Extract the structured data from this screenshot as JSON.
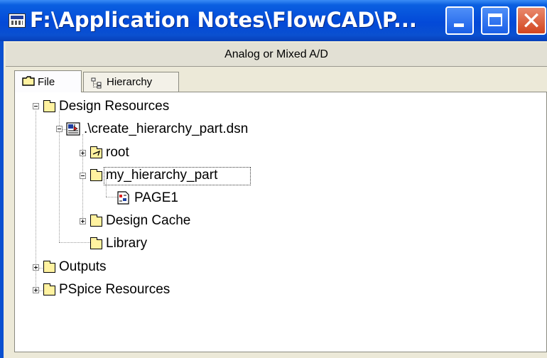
{
  "window": {
    "title": "F:\\Application Notes\\FlowCAD\\P...",
    "buttons": {
      "minimize": "minimize",
      "maximize": "maximize",
      "close": "close"
    }
  },
  "header": {
    "text": "Analog or Mixed A/D"
  },
  "tabs": [
    {
      "label": "File",
      "icon": "folder-icon",
      "active": true
    },
    {
      "label": "Hierarchy",
      "icon": "hierarchy-icon",
      "active": false
    }
  ],
  "tree": {
    "design_resources": "Design Resources",
    "dsn_file": ".\\create_hierarchy_part.dsn",
    "root": "root",
    "my_hierarchy_part": "my_hierarchy_part",
    "page1": "PAGE1",
    "design_cache": "Design Cache",
    "library": "Library",
    "outputs": "Outputs",
    "pspice_resources": "PSpice Resources"
  },
  "colors": {
    "titlebar": "#0349d8",
    "folder": "#FFF2A0",
    "panel": "#ECE9D8",
    "close_button": "#d2451f"
  }
}
